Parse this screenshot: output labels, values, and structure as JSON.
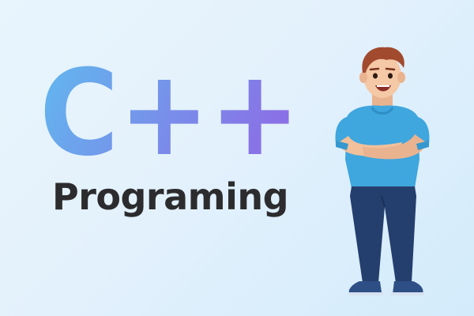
{
  "logo": {
    "language": "C++",
    "gradient_start": "#62b8ee",
    "gradient_end": "#8a6fe6"
  },
  "subtitle": "Programing",
  "character": {
    "icon": "smiling-man-arms-crossed-illustration",
    "shirt_color": "#3fa6de",
    "pants_color": "#243f6e",
    "hair_color": "#a24a2e",
    "skin_color": "#f5c8a6"
  },
  "background": {
    "color_start": "#e9f5fd",
    "color_end": "#d3ebfb"
  }
}
